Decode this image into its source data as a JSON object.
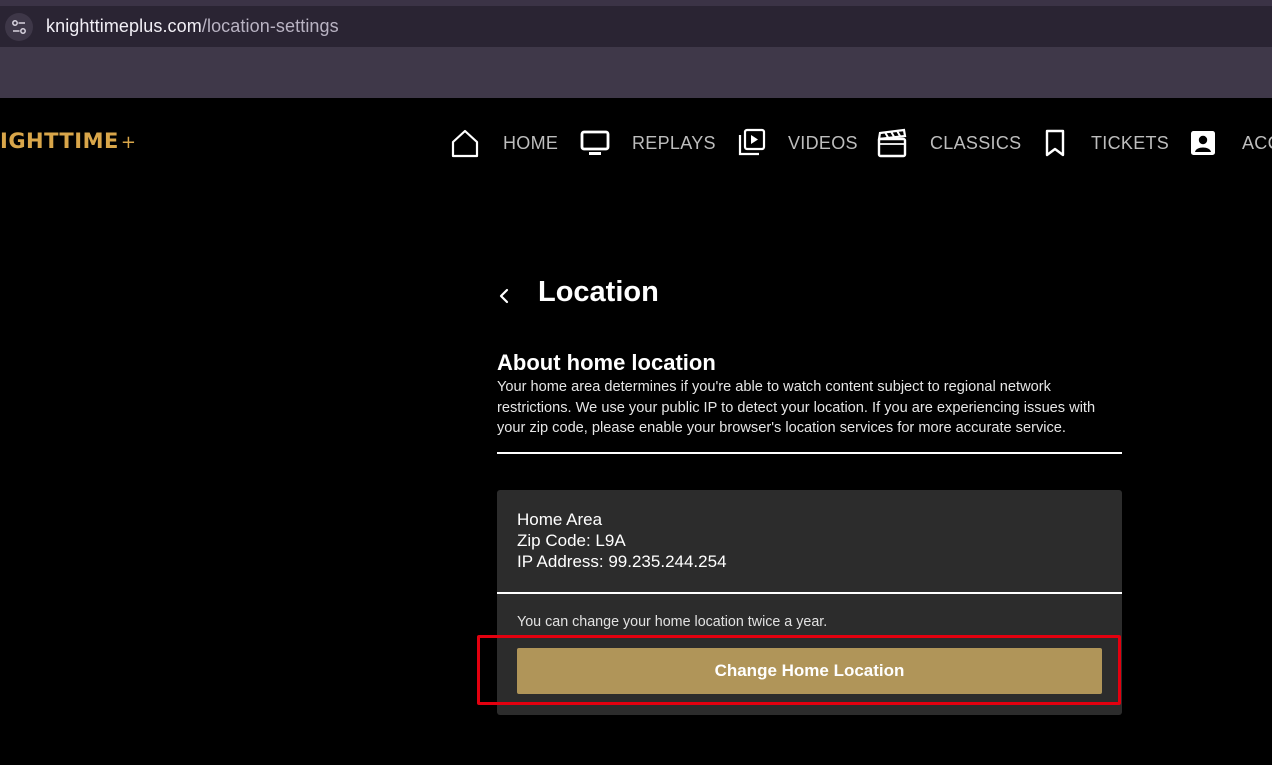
{
  "browser": {
    "url_host": "knighttimeplus.com",
    "url_path": "/location-settings",
    "site_info_icon": "tune-icon"
  },
  "header": {
    "logo_text": "IGHTTIME",
    "logo_plus": "+",
    "nav": [
      {
        "label": "HOME",
        "icon": "home-icon"
      },
      {
        "label": "REPLAYS",
        "icon": "tv-icon"
      },
      {
        "label": "VIDEOS",
        "icon": "video-library-icon"
      },
      {
        "label": "CLASSICS",
        "icon": "clapperboard-icon"
      },
      {
        "label": "TICKETS",
        "icon": "bookmark-icon"
      },
      {
        "label": "ACC",
        "icon": "account-icon"
      }
    ]
  },
  "page": {
    "title": "Location",
    "about_heading": "About home location",
    "about_text": "Your home area determines if you're able to watch content subject to regional network restrictions. We use your public IP to detect your location. If you are experiencing issues with your zip code, please enable your browser's location services for more accurate service.",
    "card": {
      "area_label": "Home Area",
      "zip_line": "Zip Code: L9A",
      "ip_line": "IP Address: 99.235.244.254",
      "note": "You can change your home location twice a year.",
      "button_label": "Change Home Location"
    }
  },
  "colors": {
    "accent_gold": "#d9a64a",
    "button_gold": "#b09559",
    "highlight_red": "#e3000f"
  }
}
